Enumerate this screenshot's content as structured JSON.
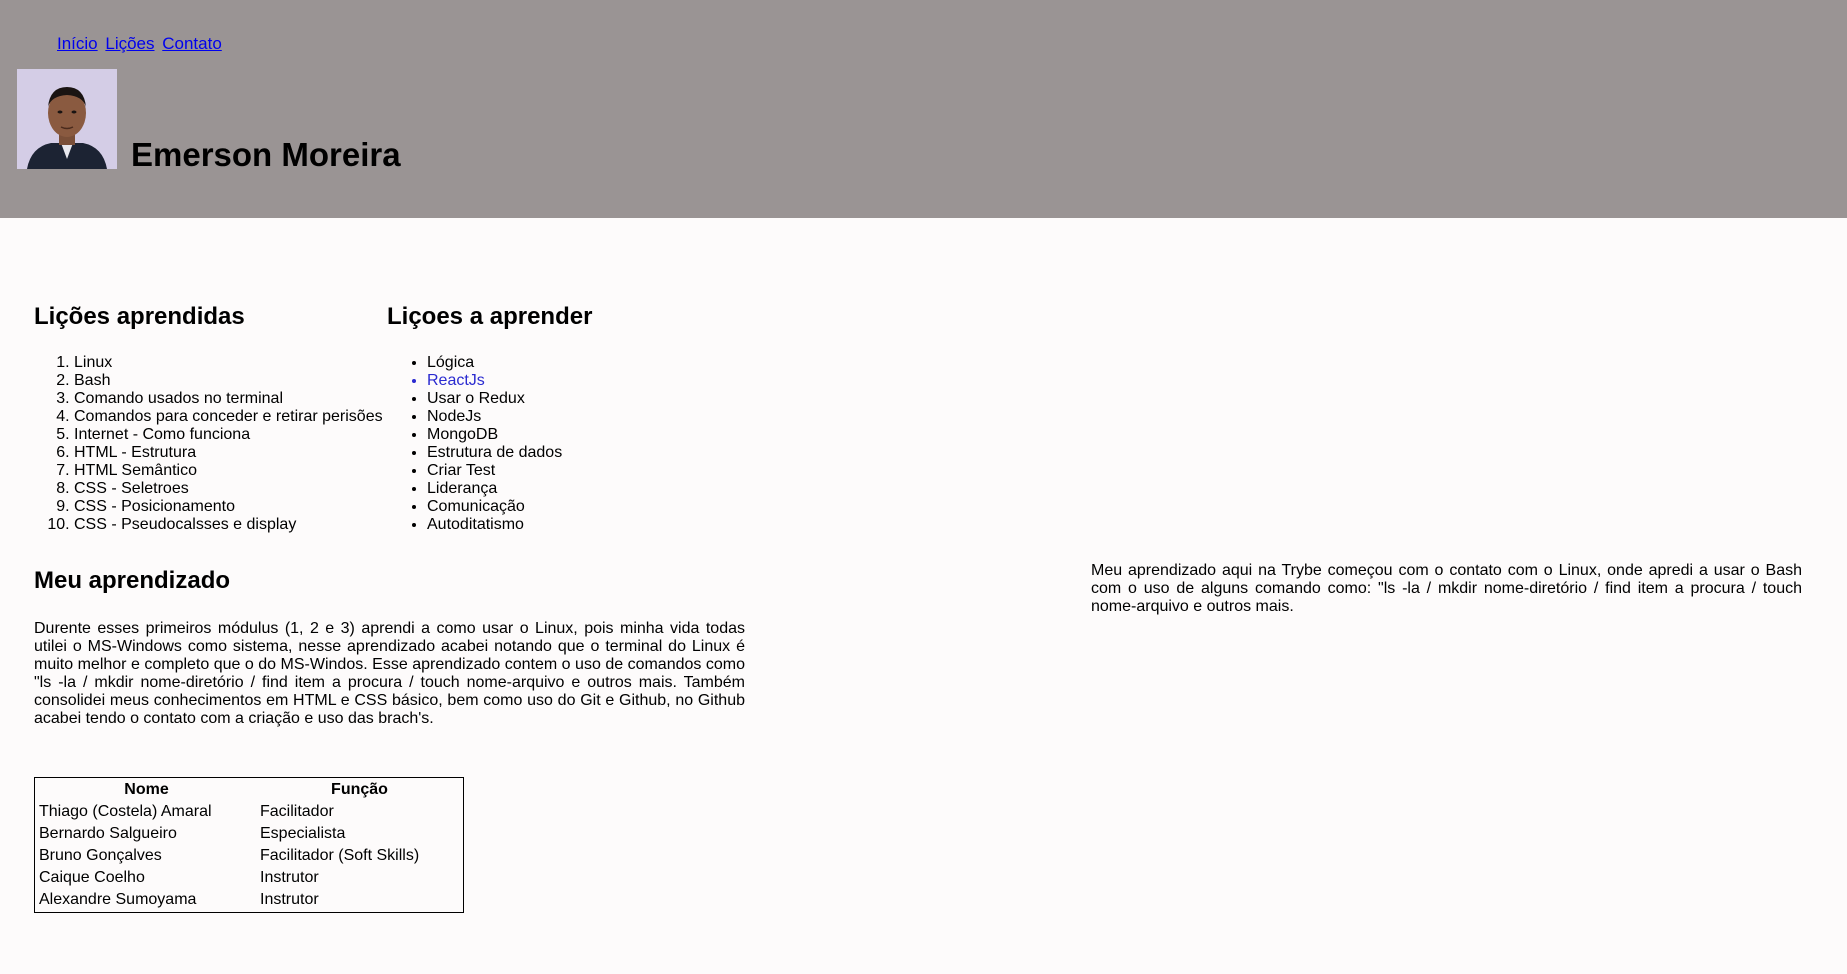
{
  "nav": {
    "links": [
      "Início",
      "Lições",
      "Contato"
    ]
  },
  "header": {
    "name": "Emerson Moreira"
  },
  "learned": {
    "title": "Lições aprendidas",
    "items": [
      "Linux",
      "Bash",
      "Comando usados no terminal",
      "Comandos para conceder e retirar perisões",
      "Internet - Como funciona",
      "HTML - Estrutura",
      "HTML Semântico",
      "CSS - Seletroes",
      "CSS - Posicionamento",
      "CSS - Pseudocalsses e display"
    ]
  },
  "to_learn": {
    "title": "Liçoes a aprender",
    "items": [
      "Lógica",
      "ReactJs",
      "Usar o Redux",
      "NodeJs",
      "MongoDB",
      "Estrutura de dados",
      "Criar Test",
      "Liderança",
      "Comunicação",
      "Autoditatismo"
    ]
  },
  "learning": {
    "title": "Meu aprendizado",
    "text": "Durente esses primeiros módulus (1, 2 e 3) aprendi a como usar o Linux, pois minha vida todas utilei o MS-Windows como sistema, nesse aprendizado acabei notando que o terminal do Linux é muito melhor e completo que o do MS-Windos. Esse aprendizado contem o uso de comandos como \"ls -la / mkdir nome-diretório / find item a procura / touch nome-arquivo e outros mais. Também consolidei meus conhecimentos em HTML e CSS básico, bem como uso do Git e Github, no Github acabei tendo o contato com a criação e uso das brach's."
  },
  "aside": {
    "text": "Meu aprendizado aqui na Trybe começou com o contato com o Linux, onde apredi a usar o Bash com o uso de alguns comando como: \"ls -la / mkdir nome-diretório / find item a procura / touch nome-arquivo e outros mais."
  },
  "team_table": {
    "headers": [
      "Nome",
      "Função"
    ],
    "rows": [
      [
        "Thiago (Costela) Amaral",
        "Facilitador"
      ],
      [
        "Bernardo Salgueiro",
        "Especialista"
      ],
      [
        "Bruno Gonçalves",
        "Facilitador (Soft Skills)"
      ],
      [
        "Caique Coelho",
        "Instrutor"
      ],
      [
        "Alexandre Sumoyama",
        "Instrutor"
      ]
    ]
  },
  "colors": {
    "header_bg": "#9a9494",
    "page_bg": "#fdfbfb",
    "link": "#0000ee",
    "list_link": "#2a2ad0"
  }
}
